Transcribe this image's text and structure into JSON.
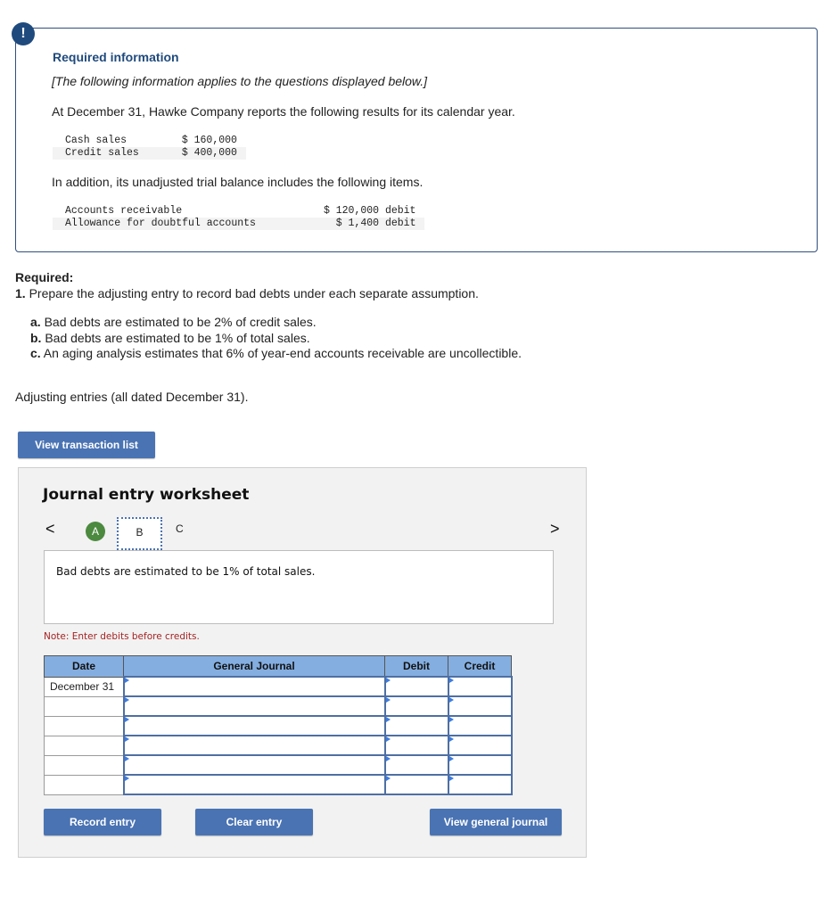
{
  "info": {
    "badge": "!",
    "title": "Required information",
    "note": "[The following information applies to the questions displayed below.]",
    "intro": "At December 31, Hawke Company reports the following results for its calendar year.",
    "sales": [
      {
        "label": "Cash sales",
        "value": "$ 160,000"
      },
      {
        "label": "Credit sales",
        "value": "$ 400,000"
      }
    ],
    "addition": "In addition, its unadjusted trial balance includes the following items.",
    "trial_balance": [
      {
        "label": "Accounts receivable",
        "value": "$ 120,000 debit"
      },
      {
        "label": "Allowance for doubtful accounts",
        "value": "$ 1,400 debit"
      }
    ]
  },
  "required": {
    "label": "Required:",
    "item1_num": "1.",
    "item1_text": " Prepare the adjusting entry to record bad debts under each separate assumption.",
    "subitems": [
      {
        "letter": "a.",
        "text": " Bad debts are estimated to be 2% of credit sales."
      },
      {
        "letter": "b.",
        "text": " Bad debts are estimated to be 1% of total sales."
      },
      {
        "letter": "c.",
        "text": " An aging analysis estimates that 6% of year-end accounts receivable are uncollectible."
      }
    ],
    "adjusting_label": "Adjusting entries (all dated December 31)."
  },
  "buttons": {
    "view_transaction_list": "View transaction list",
    "record_entry": "Record entry",
    "clear_entry": "Clear entry",
    "view_general_journal": "View general journal"
  },
  "worksheet": {
    "title": "Journal entry worksheet",
    "prev": "<",
    "next": ">",
    "tabs": [
      {
        "label": "A",
        "state": "completed"
      },
      {
        "label": "B",
        "state": "active"
      },
      {
        "label": "C",
        "state": "pending"
      }
    ],
    "description": "Bad debts are estimated to be 1% of total sales.",
    "note": "Note: Enter debits before credits.",
    "columns": [
      "Date",
      "General Journal",
      "Debit",
      "Credit"
    ],
    "rows": [
      {
        "date": "December 31",
        "account": "",
        "debit": "",
        "credit": ""
      },
      {
        "date": "",
        "account": "",
        "debit": "",
        "credit": ""
      },
      {
        "date": "",
        "account": "",
        "debit": "",
        "credit": ""
      },
      {
        "date": "",
        "account": "",
        "debit": "",
        "credit": ""
      },
      {
        "date": "",
        "account": "",
        "debit": "",
        "credit": ""
      },
      {
        "date": "",
        "account": "",
        "debit": "",
        "credit": ""
      }
    ]
  }
}
